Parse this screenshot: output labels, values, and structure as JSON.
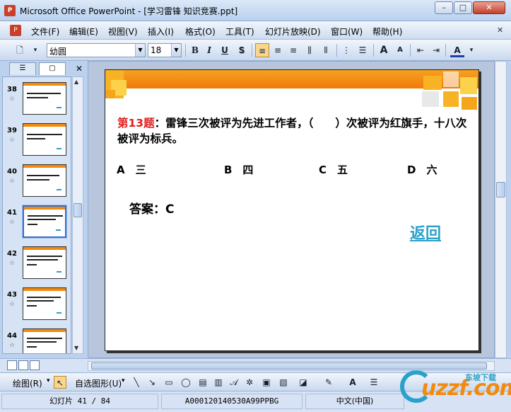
{
  "window": {
    "title": "Microsoft Office PowerPoint - [学习雷锋 知识竞赛.ppt]",
    "minimize": "–",
    "maximize": "□",
    "close": "✕"
  },
  "menu": {
    "items": [
      "文件(F)",
      "编辑(E)",
      "视图(V)",
      "插入(I)",
      "格式(O)",
      "工具(T)",
      "幻灯片放映(D)",
      "窗口(W)",
      "帮助(H)"
    ],
    "close_glyph": "✕"
  },
  "toolbar": {
    "font": "幼圆",
    "size": "18",
    "bold": "B",
    "italic": "I",
    "underline": "U",
    "shadow": "S",
    "increase_font": "A",
    "decrease_font": "A",
    "font_color": "A"
  },
  "panes": {
    "outline_tab": "☰",
    "slides_tab": "▢",
    "close": "✕"
  },
  "thumbnails": [
    {
      "num": "38",
      "selected": false
    },
    {
      "num": "39",
      "selected": false
    },
    {
      "num": "40",
      "selected": false
    },
    {
      "num": "41",
      "selected": true
    },
    {
      "num": "42",
      "selected": false
    },
    {
      "num": "43",
      "selected": false
    },
    {
      "num": "44",
      "selected": false
    }
  ],
  "slide": {
    "question_num": "第13题",
    "question_text": "：雷锋三次被评为先进工作者，（　　）次被评为红旗手，十八次被评为标兵。",
    "options": [
      "A　三",
      "B　四",
      "C　五",
      "D　六"
    ],
    "answer": "答案：C",
    "return": "返回"
  },
  "draw_toolbar": {
    "draw": "绘图(R)",
    "autoshapes": "自选图形(U)"
  },
  "status": {
    "slide": "幻灯片 41 / 84",
    "design": "A000120140530A99PPBG",
    "language": "中文(中国)"
  },
  "watermark": {
    "brand": "uzzf.com",
    "sub": "东坡下载"
  },
  "colors": {
    "banner": "#f28a0d",
    "question_num": "#e01d1d",
    "link": "#2aa1c8"
  }
}
